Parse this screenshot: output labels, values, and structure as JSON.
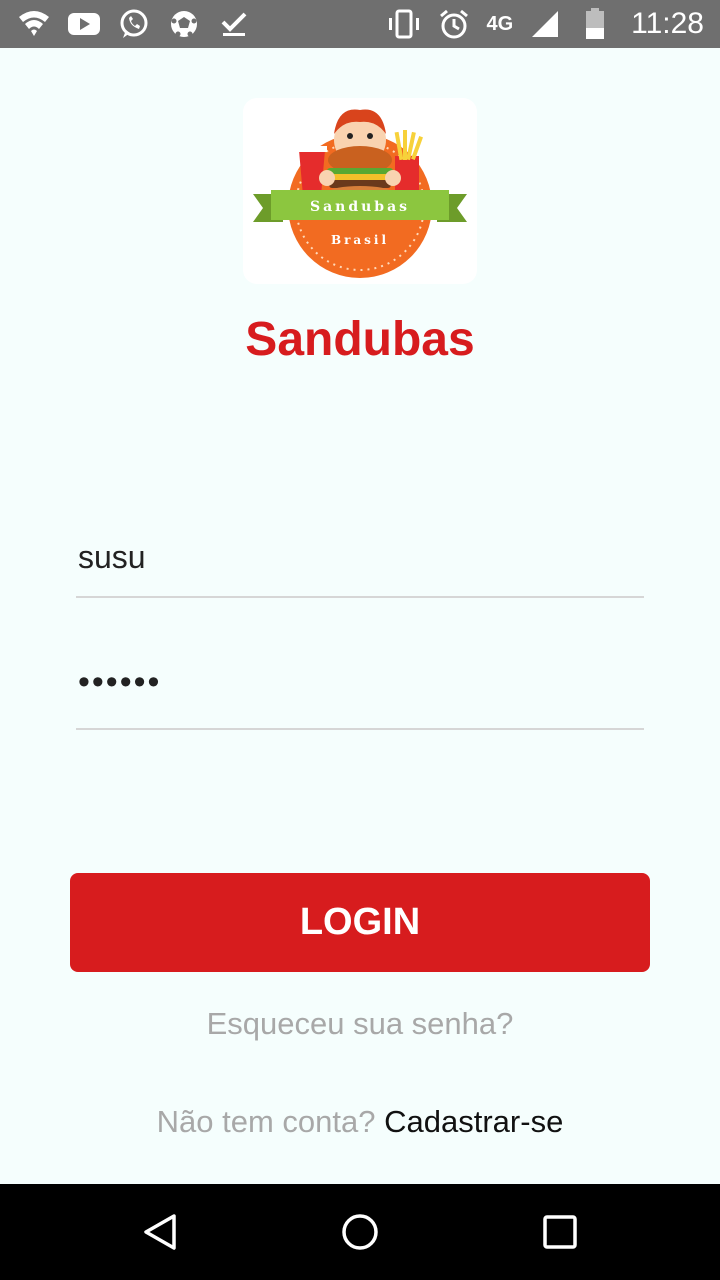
{
  "status_bar": {
    "time": "11:28",
    "network": "4G",
    "left_icons": [
      "wifi-signal-icon",
      "youtube-icon",
      "whatsapp-icon",
      "soccer-ball-icon",
      "download-done-icon"
    ],
    "right_icons": [
      "vibrate-icon",
      "alarm-icon",
      "cell-signal-icon",
      "battery-icon"
    ]
  },
  "app": {
    "logo_text_top": "Sandubas",
    "logo_text_bottom": "Brasil",
    "title": "Sandubas"
  },
  "form": {
    "username_value": "susu",
    "password_value": "••••••"
  },
  "actions": {
    "login_label": "LOGIN",
    "forgot_label": "Esqueceu sua senha?",
    "no_account_label": "Não tem conta?",
    "signup_label": "Cadastrar-se"
  },
  "colors": {
    "accent": "#d71c1e",
    "background": "#f5fefd",
    "status_bar": "#6f6f6f",
    "nav_bar": "#000000"
  }
}
